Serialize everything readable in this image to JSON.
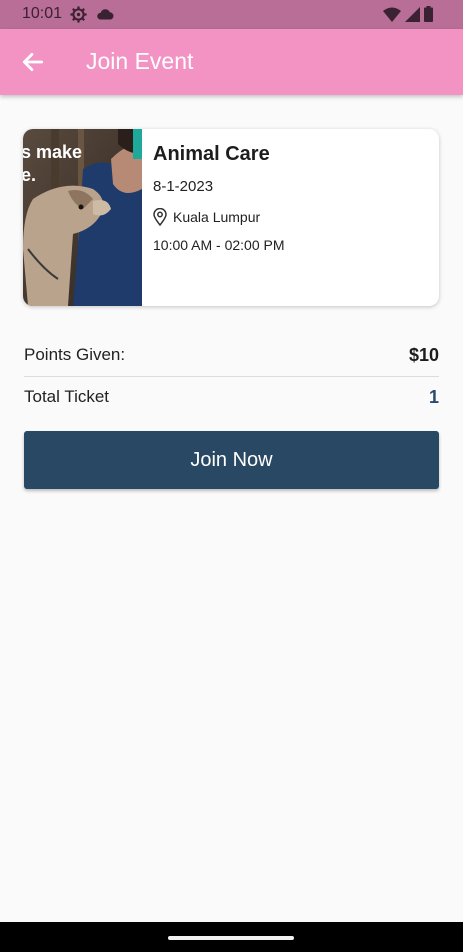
{
  "status_bar": {
    "time": "10:01",
    "left_icons": [
      "gear-icon",
      "cloud-icon"
    ],
    "right_icons": [
      "wifi-icon",
      "signal-icon",
      "battery-icon"
    ]
  },
  "app_bar": {
    "title": "Join Event",
    "back_icon": "arrow-left-icon",
    "color": "#f393c4"
  },
  "event": {
    "name": "Animal Care",
    "date": "8-1-2023",
    "location": "Kuala Lumpur",
    "time": "10:00 AM - 02:00 PM",
    "image_caption": "s make\ne."
  },
  "summary": {
    "points_label": "Points Given:",
    "points_value": "$10",
    "tickets_label": "Total Ticket",
    "tickets_value": "1",
    "tickets_value_color": "#2a4a6e"
  },
  "actions": {
    "join_label": "Join Now",
    "button_color": "#284863"
  }
}
